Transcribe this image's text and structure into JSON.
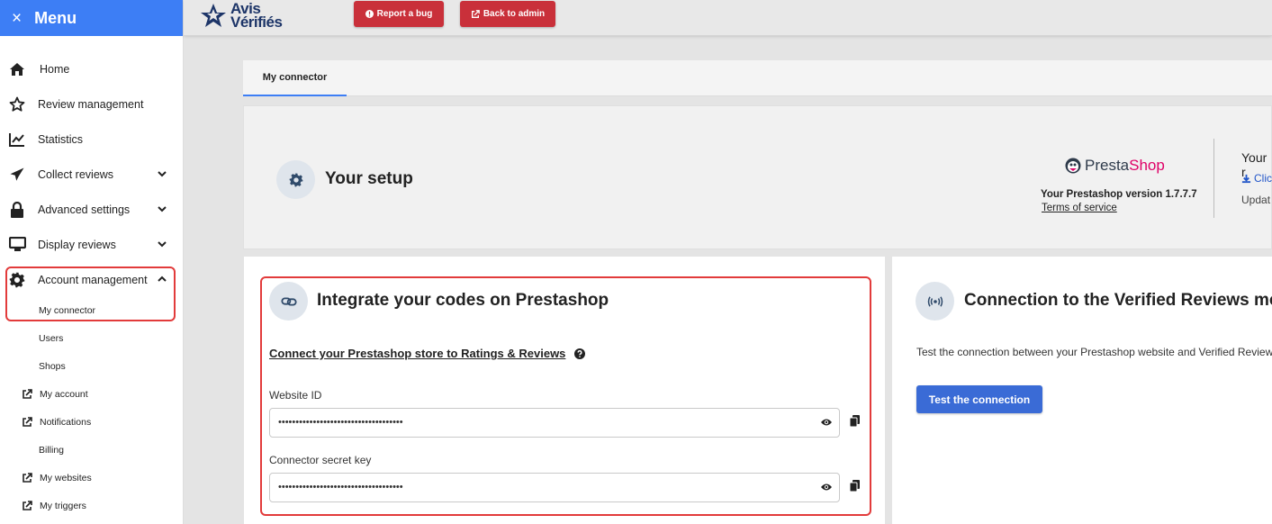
{
  "menu": {
    "close_icon": "×",
    "title": "Menu"
  },
  "sidebar": {
    "items": [
      {
        "label": "Home",
        "icon": "home-icon"
      },
      {
        "label": "Review management",
        "icon": "star-icon"
      },
      {
        "label": "Statistics",
        "icon": "chart-line-icon"
      },
      {
        "label": "Collect reviews",
        "icon": "paper-plane-icon",
        "expanded": false
      },
      {
        "label": "Advanced settings",
        "icon": "lock-icon",
        "expanded": false
      },
      {
        "label": "Display reviews",
        "icon": "monitor-icon",
        "expanded": false
      },
      {
        "label": "Account management",
        "icon": "gear-icon",
        "expanded": true
      }
    ],
    "subitems": [
      {
        "label": "My connector",
        "external": false,
        "active": true
      },
      {
        "label": "Users",
        "external": false
      },
      {
        "label": "Shops",
        "external": false
      },
      {
        "label": "My account",
        "external": true
      },
      {
        "label": "Notifications",
        "external": true
      },
      {
        "label": "Billing",
        "external": false
      },
      {
        "label": "My websites",
        "external": true
      },
      {
        "label": "My triggers",
        "external": true
      }
    ]
  },
  "header": {
    "logo_line1": "Avis",
    "logo_line2": "Vérifiés",
    "report_bug": "Report a bug",
    "back_to_admin": "Back to admin"
  },
  "tabs": [
    {
      "label": "My connector",
      "active": true
    }
  ],
  "setup": {
    "title": "Your setup",
    "prestashop_logo_a": "Presta",
    "prestashop_logo_b": "Shop",
    "version": "Your Prestashop version 1.7.7.7",
    "terms": "Terms of service",
    "your_label": "Your r",
    "click_label": "Clic",
    "update_label": "Updat"
  },
  "integrate": {
    "title": "Integrate your codes on Prestashop",
    "connect_link": "Connect your Prestashop store to Ratings & Reviews",
    "website_id_label": "Website ID",
    "website_id_value": "••••••••••••••••••••••••••••••••••••",
    "secret_key_label": "Connector secret key",
    "secret_key_value": "••••••••••••••••••••••••••••••••••••"
  },
  "connection": {
    "title": "Connection to the Verified Reviews mo",
    "description": "Test the connection between your Prestashop website and Verified Review",
    "test_button": "Test the connection"
  },
  "colors": {
    "menu_blue": "#3d7ef5",
    "danger_red": "#c9303a",
    "primary_blue": "#3a6bd6",
    "prestashop_pink": "#df0067"
  }
}
